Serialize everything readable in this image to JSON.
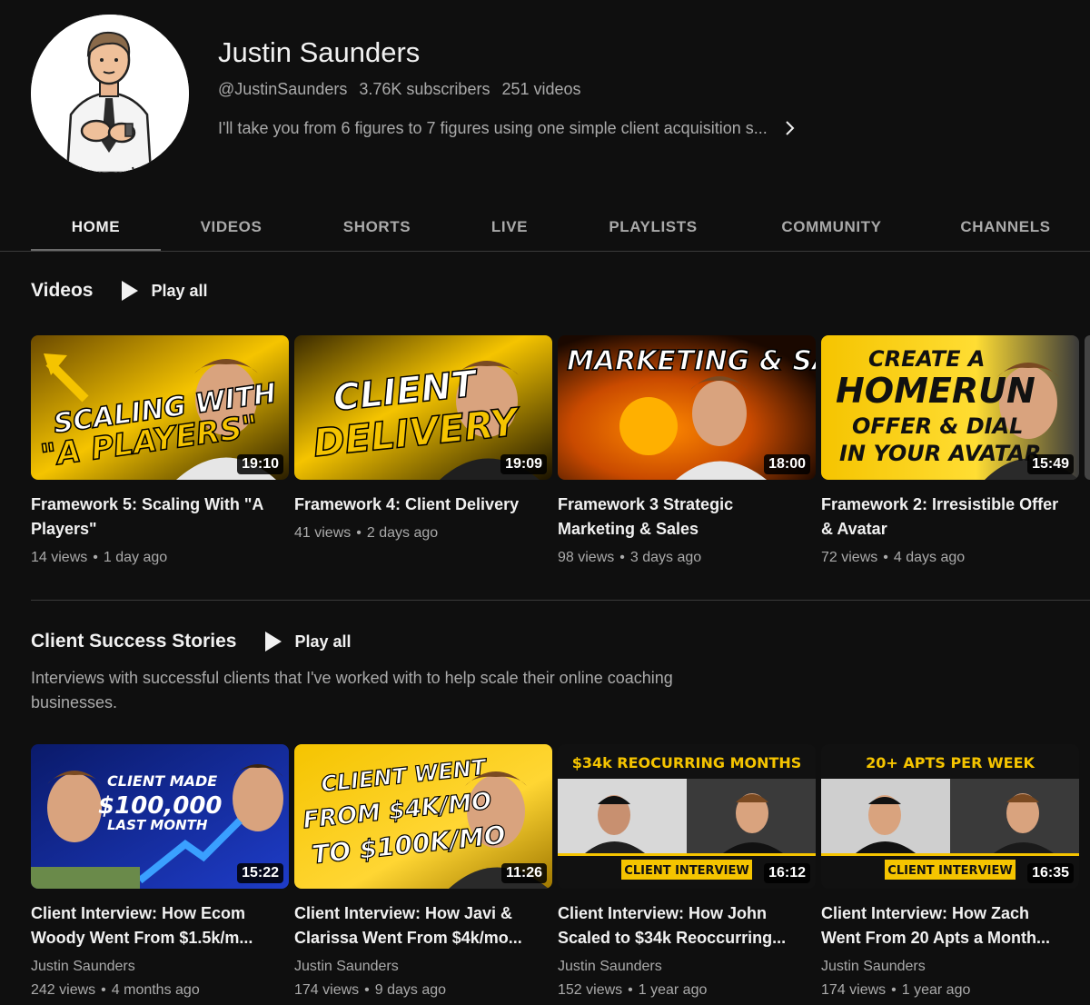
{
  "channel": {
    "name": "Justin Saunders",
    "handle": "@JustinSaunders",
    "subscribers": "3.76K subscribers",
    "videos_count": "251 videos",
    "description": "I'll take you from 6 figures to 7 figures using one simple client acquisition s..."
  },
  "tabs": [
    {
      "label": "HOME",
      "active": true
    },
    {
      "label": "VIDEOS"
    },
    {
      "label": "SHORTS"
    },
    {
      "label": "LIVE"
    },
    {
      "label": "PLAYLISTS"
    },
    {
      "label": "COMMUNITY"
    },
    {
      "label": "CHANNELS"
    }
  ],
  "shelf_videos": {
    "title": "Videos",
    "play_all": "Play all",
    "items": [
      {
        "title": "Framework 5: Scaling With \"A Players\"",
        "views": "14 views",
        "age": "1 day ago",
        "duration": "19:10",
        "thumb_text": [
          "SCALING WITH",
          "\"A PLAYERS\""
        ]
      },
      {
        "title": "Framework 4: Client Delivery",
        "views": "41 views",
        "age": "2 days ago",
        "duration": "19:09",
        "thumb_text": [
          "CLIENT",
          "DELIVERY"
        ]
      },
      {
        "title": "Framework 3 Strategic Marketing & Sales",
        "views": "98 views",
        "age": "3 days ago",
        "duration": "18:00",
        "thumb_text": [
          "MARKETING & SALES"
        ]
      },
      {
        "title": "Framework 2: Irresistible Offer & Avatar",
        "views": "72 views",
        "age": "4 days ago",
        "duration": "15:49",
        "thumb_text": [
          "CREATE A",
          "HOMERUN",
          "OFFER & DIAL",
          "IN YOUR AVATAR"
        ]
      }
    ]
  },
  "shelf_success": {
    "title": "Client Success Stories",
    "play_all": "Play all",
    "description": "Interviews with successful clients that I've worked with to help scale their online coaching businesses.",
    "items": [
      {
        "title": "Client Interview: How Ecom Woody Went From $1.5k/m...",
        "channel": "Justin Saunders",
        "views": "242 views",
        "age": "4 months ago",
        "duration": "15:22",
        "thumb_text": [
          "CLIENT MADE",
          "$100,000",
          "LAST MONTH"
        ]
      },
      {
        "title": "Client Interview: How Javi & Clarissa Went From $4k/mo...",
        "channel": "Justin Saunders",
        "views": "174 views",
        "age": "9 days ago",
        "duration": "11:26",
        "thumb_text": [
          "CLIENT WENT",
          "FROM $4K/MO",
          "TO $100K/MO"
        ]
      },
      {
        "title": "Client Interview: How John Scaled to $34k Reoccurring...",
        "channel": "Justin Saunders",
        "views": "152 views",
        "age": "1 year ago",
        "duration": "16:12",
        "thumb_text": [
          "$34k REOCURRING MONTHS",
          "CLIENT INTERVIEW"
        ]
      },
      {
        "title": "Client Interview: How Zach Went From 20 Apts a Month...",
        "channel": "Justin Saunders",
        "views": "174 views",
        "age": "1 year ago",
        "duration": "16:35",
        "thumb_text": [
          "20+ APTS PER WEEK",
          "CLIENT INTERVIEW"
        ]
      }
    ]
  },
  "colors": {
    "background": "#0f0f0f",
    "text_primary": "#f1f1f1",
    "text_secondary": "#aaaaaa",
    "divider": "#3a3a3a",
    "thumb_yellow": "#f5c400"
  }
}
